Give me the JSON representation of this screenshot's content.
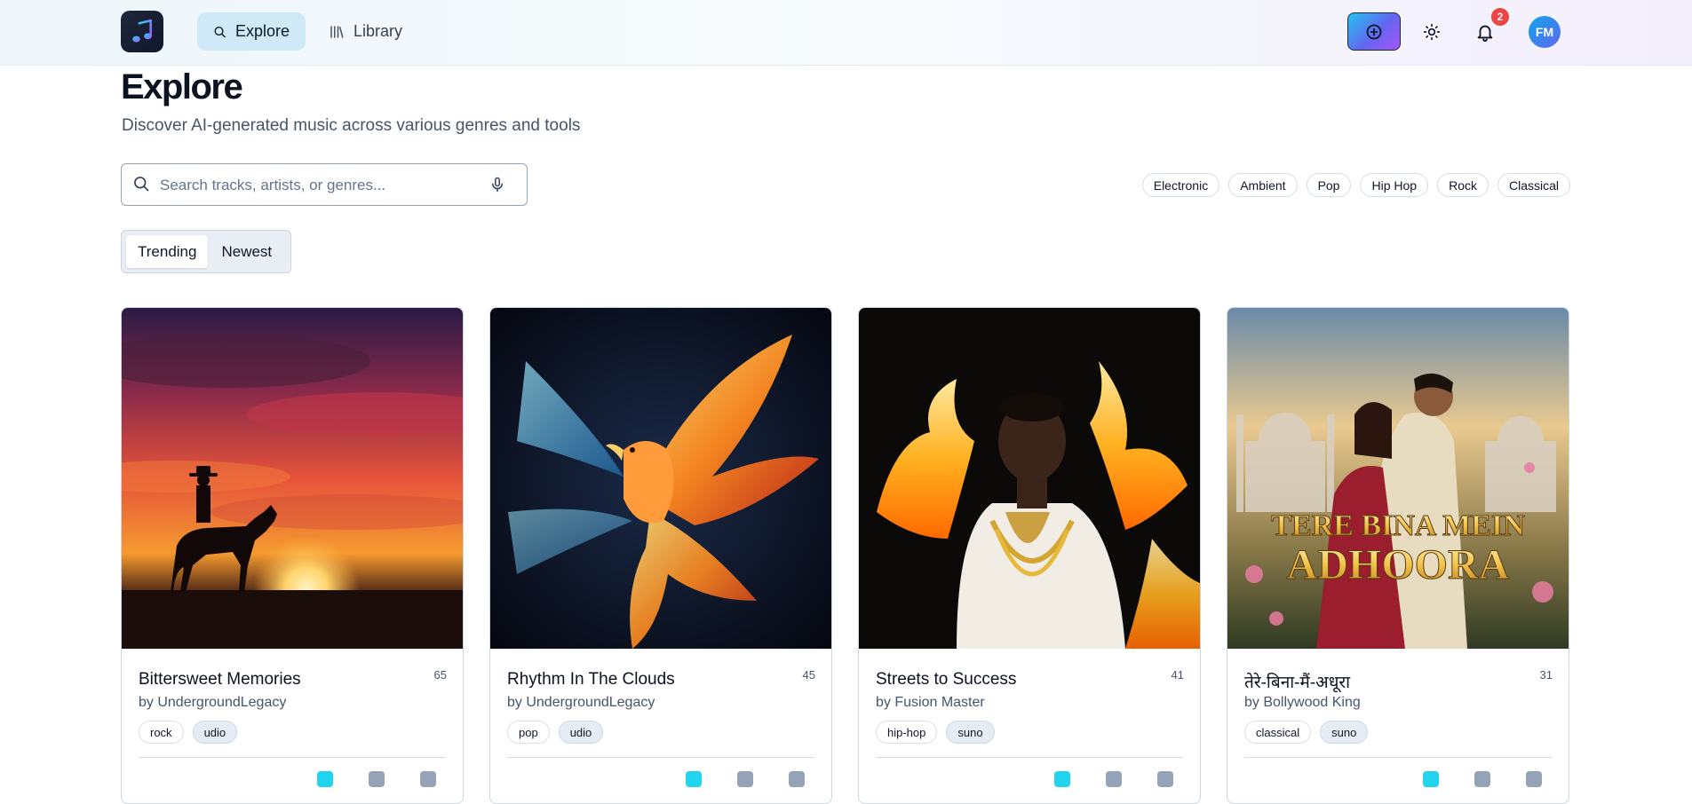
{
  "header": {
    "nav": [
      {
        "label": "Explore",
        "icon": "search-icon",
        "active": true
      },
      {
        "label": "Library",
        "icon": "library-icon",
        "active": false
      }
    ],
    "notifications_count": "2",
    "avatar_initials": "FM",
    "accent_gradient": [
      "#22c3ee",
      "#6366f1",
      "#a855f7"
    ]
  },
  "page": {
    "title": "Explore",
    "subtitle": "Discover AI-generated music across various genres and tools"
  },
  "search": {
    "placeholder": "Search tracks, artists, or genres...",
    "value": ""
  },
  "genres": [
    "Electronic",
    "Ambient",
    "Pop",
    "Hip Hop",
    "Rock",
    "Classical"
  ],
  "sort_tabs": [
    {
      "label": "Trending",
      "active": true
    },
    {
      "label": "Newest",
      "active": false
    }
  ],
  "tracks": [
    {
      "title": "Bittersweet Memories",
      "artist": "by UndergroundLegacy",
      "count": "65",
      "genre_tag": "rock",
      "tool_tag": "udio",
      "art": "cowboy-sunset"
    },
    {
      "title": "Rhythm In The Clouds",
      "artist": "by UndergroundLegacy",
      "count": "45",
      "genre_tag": "pop",
      "tool_tag": "udio",
      "art": "fire-phoenix"
    },
    {
      "title": "Streets to Success",
      "artist": "by Fusion Master",
      "count": "41",
      "genre_tag": "hip-hop",
      "tool_tag": "suno",
      "art": "man-in-flames"
    },
    {
      "title": "तेरे-बिना-मैं-अधूरा",
      "artist": "by Bollywood King",
      "count": "31",
      "genre_tag": "classical",
      "tool_tag": "suno",
      "art": "taj-mahal-couple",
      "art_text_line1": "TERE BINA MEIN",
      "art_text_line2": "ADHOORA"
    }
  ]
}
